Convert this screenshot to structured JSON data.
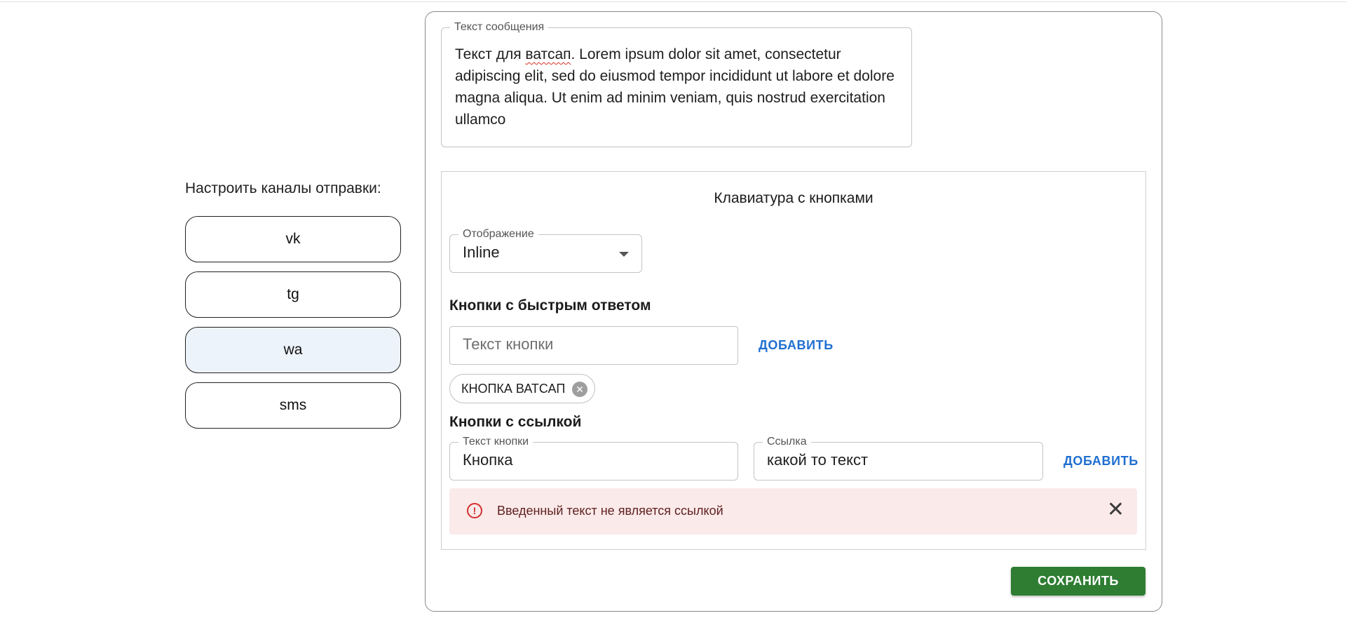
{
  "channels": {
    "title": "Настроить каналы отправки:",
    "items": [
      {
        "label": "vk",
        "active": false
      },
      {
        "label": "tg",
        "active": false
      },
      {
        "label": "wa",
        "active": true
      },
      {
        "label": "sms",
        "active": false
      }
    ]
  },
  "message": {
    "legend": "Текст сообщения",
    "text_before": "Текст для ",
    "text_misspelled": "ватсап",
    "text_after": ". Lorem ipsum dolor sit amet, consectetur adipiscing elit, sed do eiusmod tempor incididunt ut labore et dolore magna aliqua. Ut enim ad minim veniam, quis nostrud exercitation ullamco"
  },
  "keyboard": {
    "title": "Клавиатура с кнопками",
    "display": {
      "legend": "Отображение",
      "value": "Inline"
    },
    "quick_reply": {
      "title": "Кнопки с быстрым ответом",
      "input_placeholder": "Текст кнопки",
      "add_label": "ДОБАВИТЬ",
      "chips": [
        {
          "label": "КНОПКА ВАТСАП"
        }
      ]
    },
    "link_buttons": {
      "title": "Кнопки с ссылкой",
      "text_legend": "Текст кнопки",
      "text_value": "Кнопка",
      "url_legend": "Ссылка",
      "url_value": "какой то текст",
      "add_label": "ДОБАВИТЬ"
    },
    "alert": {
      "text": "Введенный текст не является ссылкой",
      "icon": "error-icon"
    }
  },
  "save_label": "СОХРАНИТЬ",
  "colors": {
    "accent": "#1f6fd0",
    "save": "#2e7d32",
    "alert_bg": "#fbeaea",
    "error": "#d32f2f",
    "active_channel": "#edf3fb"
  }
}
